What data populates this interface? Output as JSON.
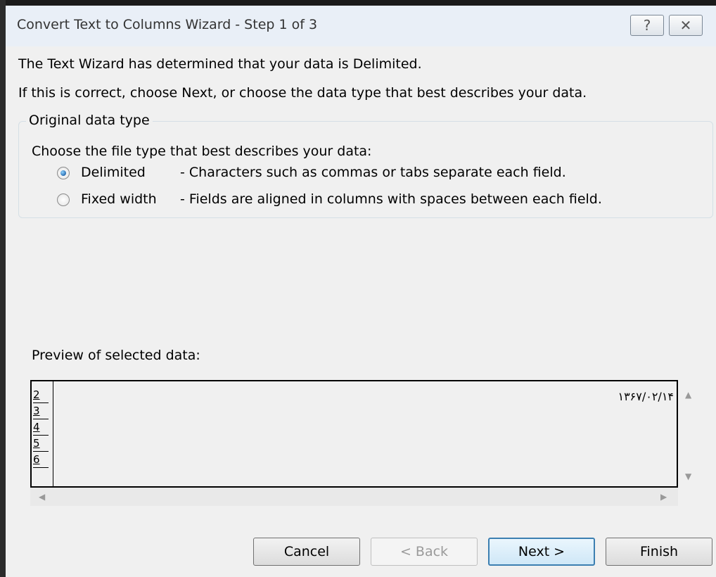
{
  "window": {
    "title": "Convert Text to Columns Wizard - Step 1 of 3",
    "help_icon": "help-icon",
    "close_icon": "close-icon"
  },
  "intro": {
    "line1": "The Text Wizard has determined that your data is Delimited.",
    "line2": "If this is correct, choose Next, or choose the data type that best describes your data."
  },
  "original_data_type": {
    "label": "Original data type",
    "prompt": "Choose the file type that best describes your data:",
    "options": [
      {
        "label": "Delimited",
        "description": "- Characters such as commas or tabs separate each field.",
        "selected": true
      },
      {
        "label": "Fixed width",
        "description": "- Fields are aligned in columns with spaces between each field.",
        "selected": false
      }
    ]
  },
  "preview": {
    "label": "Preview of selected data:",
    "rows": [
      {
        "num": "2",
        "text": "۱۳۶۷/۰۲/۱۴"
      },
      {
        "num": "3",
        "text": ""
      },
      {
        "num": "4",
        "text": ""
      },
      {
        "num": "5",
        "text": ""
      },
      {
        "num": "6",
        "text": ""
      }
    ]
  },
  "buttons": {
    "cancel": "Cancel",
    "back": "< Back",
    "next": "Next >",
    "finish": "Finish"
  },
  "colors": {
    "dialog_bg": "#f0f0f0",
    "titlebar_bg": "#e9eff7",
    "default_button_border": "#3c7fb1"
  }
}
